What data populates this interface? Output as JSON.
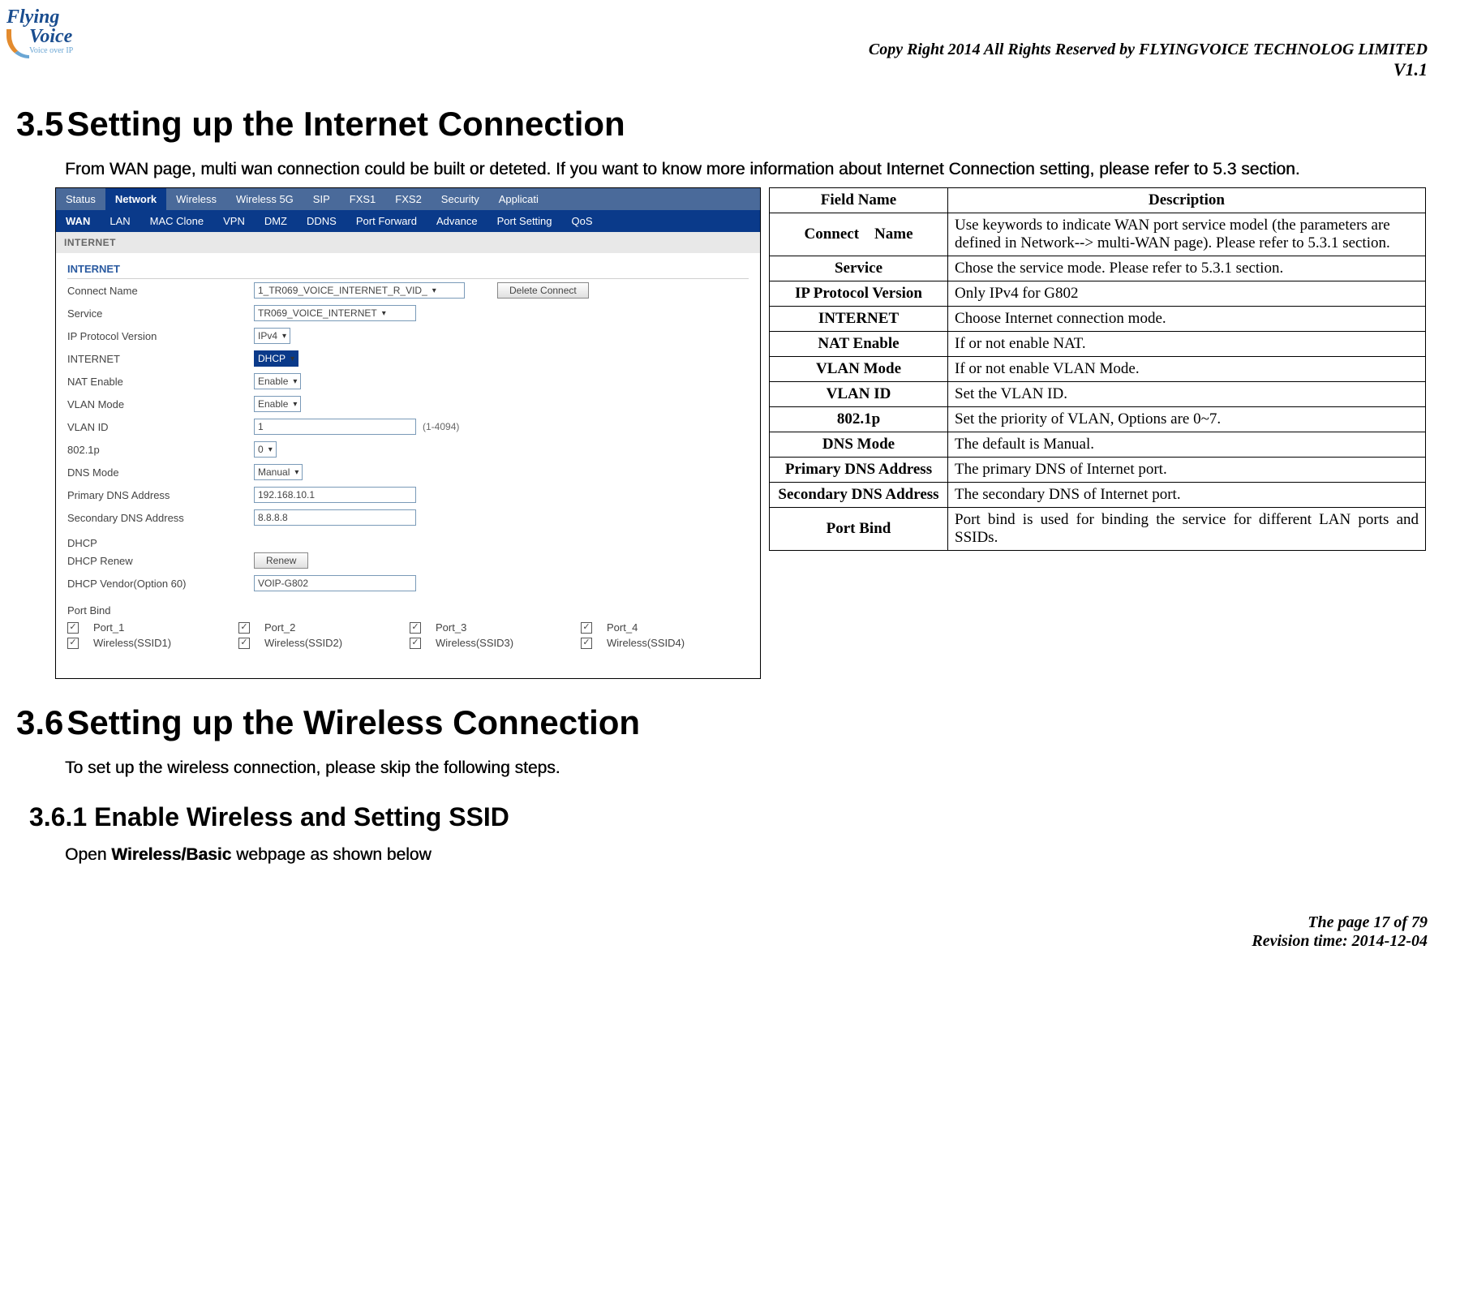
{
  "header": {
    "logo_top": "Flying",
    "logo_bottom": "Voice",
    "logo_sub": "Voice over IP",
    "copyright": "Copy Right 2014 All Rights Reserved by FLYINGVOICE TECHNOLOG LIMITED",
    "version": "V1.1"
  },
  "sections": {
    "s35_num": "3.5",
    "s35_title": "Setting up the Internet Connection",
    "s35_intro": "From WAN page, multi wan connection could be built or deteted. If you want to know more information about Internet Connection setting, please refer to 5.3 section.",
    "s36_num": "3.6",
    "s36_title": "Setting up the Wireless Connection",
    "s36_intro": "To set up the wireless connection, please skip the following steps.",
    "s361_num": "3.6.1",
    "s361_title": "Enable Wireless and Setting SSID",
    "s361_intro_pre": "Open ",
    "s361_intro_bold": "Wireless/Basic",
    "s361_intro_post": " webpage as shown below"
  },
  "screenshot": {
    "tabs1": [
      "Status",
      "Network",
      "Wireless",
      "Wireless 5G",
      "SIP",
      "FXS1",
      "FXS2",
      "Security",
      "Applicati"
    ],
    "tabs1_active": 1,
    "tabs2": [
      "WAN",
      "LAN",
      "MAC Clone",
      "VPN",
      "DMZ",
      "DDNS",
      "Port Forward",
      "Advance",
      "Port Setting",
      "QoS"
    ],
    "tabs2_active": 0,
    "band": "INTERNET",
    "panel1": "INTERNET",
    "rows": {
      "connect_label": "Connect Name",
      "connect_value": "1_TR069_VOICE_INTERNET_R_VID_",
      "delete_btn": "Delete Connect",
      "service_label": "Service",
      "service_value": "TR069_VOICE_INTERNET",
      "ipver_label": "IP Protocol Version",
      "ipver_value": "IPv4",
      "internet_label": "INTERNET",
      "internet_value": "DHCP",
      "nat_label": "NAT Enable",
      "nat_value": "Enable",
      "vlanmode_label": "VLAN Mode",
      "vlanmode_value": "Enable",
      "vlanid_label": "VLAN ID",
      "vlanid_value": "1",
      "vlanid_note": "(1-4094)",
      "p8021_label": "802.1p",
      "p8021_value": "0",
      "dnsmode_label": "DNS Mode",
      "dnsmode_value": "Manual",
      "pdns_label": "Primary DNS Address",
      "pdns_value": "192.168.10.1",
      "sdns_label": "Secondary DNS Address",
      "sdns_value": "8.8.8.8"
    },
    "dhcp_title": "DHCP",
    "dhcp_renew_label": "DHCP Renew",
    "dhcp_renew_btn": "Renew",
    "dhcp_vendor_label": "DHCP Vendor(Option 60)",
    "dhcp_vendor_value": "VOIP-G802",
    "portbind_title": "Port Bind",
    "portbind": [
      "Port_1",
      "Port_2",
      "Port_3",
      "Port_4",
      "Wireless(SSID1)",
      "Wireless(SSID2)",
      "Wireless(SSID3)",
      "Wireless(SSID4)"
    ]
  },
  "desc_table": {
    "h1": "Field Name",
    "h2": "Description",
    "rows": [
      {
        "f": "Connect    Name",
        "d": "Use keywords to indicate WAN port service model (the parameters are defined in Network--> multi-WAN page). Please refer to 5.3.1 section."
      },
      {
        "f": "Service",
        "d": "Chose the service mode. Please refer to 5.3.1 section."
      },
      {
        "f": "IP Protocol Version",
        "d": "Only IPv4 for G802"
      },
      {
        "f": "INTERNET",
        "d": "Choose Internet connection mode."
      },
      {
        "f": "NAT Enable",
        "d": "If or not enable NAT."
      },
      {
        "f": "VLAN Mode",
        "d": "If or not enable VLAN Mode."
      },
      {
        "f": "VLAN ID",
        "d": "Set the VLAN ID."
      },
      {
        "f": "802.1p",
        "d": "Set the priority of VLAN, Options are 0~7."
      },
      {
        "f": "DNS Mode",
        "d": "The default is Manual."
      },
      {
        "f": "Primary DNS Address",
        "d": "The primary DNS of Internet port."
      },
      {
        "f": "Secondary DNS Address",
        "d": "The secondary DNS of Internet port."
      },
      {
        "f": "Port Bind",
        "d": "Port bind is used for binding the service for different LAN ports and SSIDs."
      }
    ]
  },
  "footer": {
    "page": "The page 17 of 79",
    "rev": "Revision time: 2014-12-04"
  }
}
